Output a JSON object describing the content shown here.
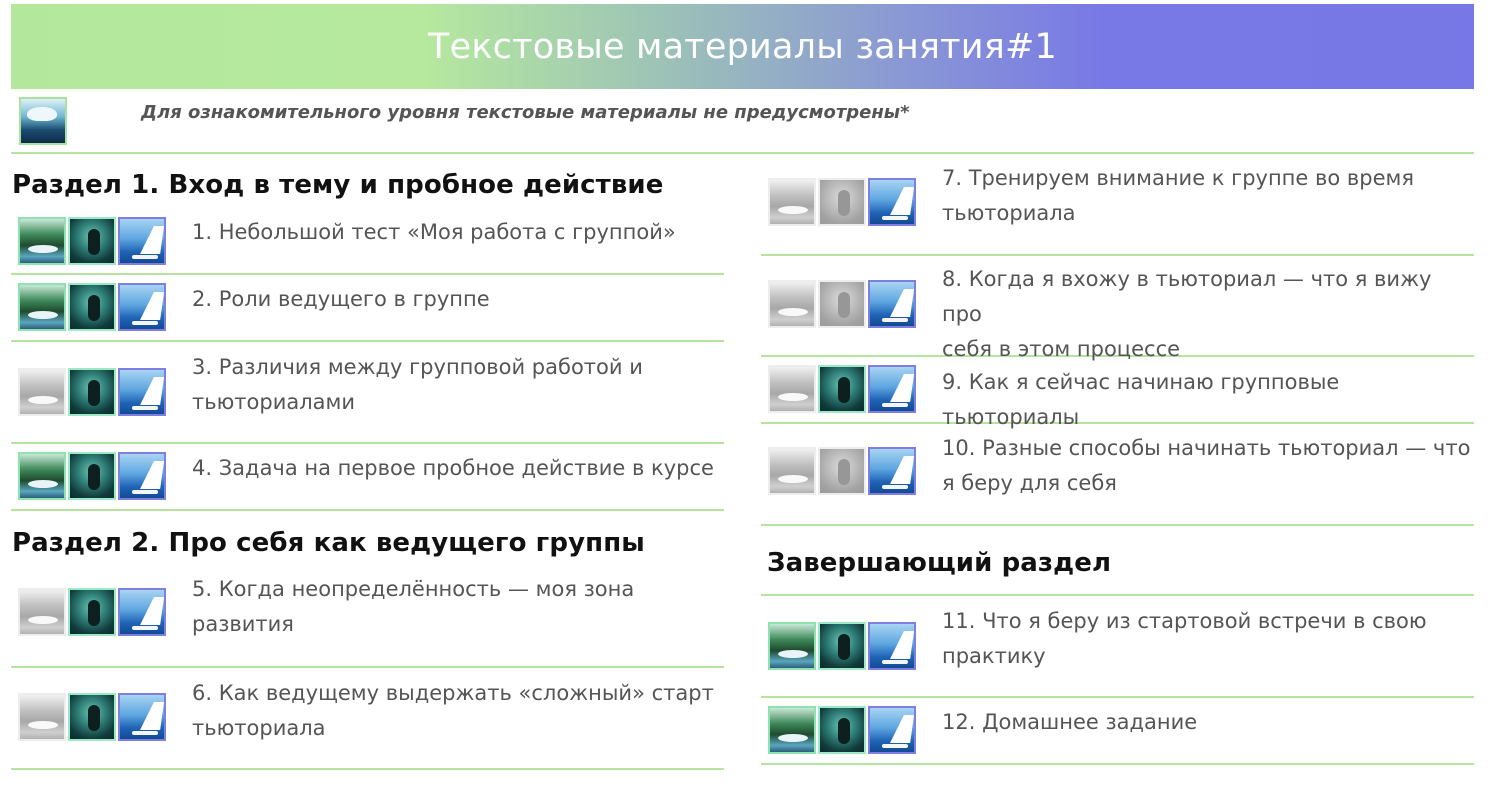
{
  "banner": {
    "title": "Текстовые материалы занятия#1"
  },
  "note": {
    "text": "Для ознакомительного уровня текстовые материалы не предусмотрены*",
    "thumb_icon": "water-hand-icon"
  },
  "left": {
    "section1": {
      "title": "Раздел 1. Вход в тему и пробное действие"
    },
    "items1": [
      {
        "label": "1. Небольшой тест «Моя работа с группой»"
      },
      {
        "label": "2. Роли ведущего в группе"
      },
      {
        "label_line1": "3. Различия между групповой работой и",
        "label_line2": "тьюториалами"
      },
      {
        "label": "4. Задача на первое пробное действие в курсе"
      }
    ],
    "section2": {
      "title": "Раздел 2. Про себя как ведущего группы"
    },
    "items2": [
      {
        "label_line1": "5. Когда неопределённость — моя зона",
        "label_line2": "развития"
      },
      {
        "label_line1": "6. Как ведущему выдержать «сложный» старт",
        "label_line2": "тьюториала"
      }
    ]
  },
  "right": {
    "items1": [
      {
        "label_line1": "7. Тренируем внимание к группе во время",
        "label_line2": "тьюториала"
      },
      {
        "label_line1": "8. Когда я вхожу в тьюториал — что я вижу про",
        "label_line2": "себя в этом процессе"
      },
      {
        "label": "9. Как я сейчас начинаю групповые тьюториалы"
      },
      {
        "label_line1": "10. Разные способы начинать тьюториал — что",
        "label_line2": "я беру для себя"
      }
    ],
    "section3": {
      "title": "Завершающий раздел"
    },
    "items2": [
      {
        "label_line1": "11. Что я беру из стартовой встречи в свою",
        "label_line2": "практику"
      },
      {
        "label": "12. Домашнее задание"
      }
    ]
  },
  "colors": {
    "banner_start": "#b3e89c",
    "banner_end": "#7777e6",
    "divider": "#b6e3a0",
    "section_title": "#111111",
    "item_text": "#555555"
  }
}
